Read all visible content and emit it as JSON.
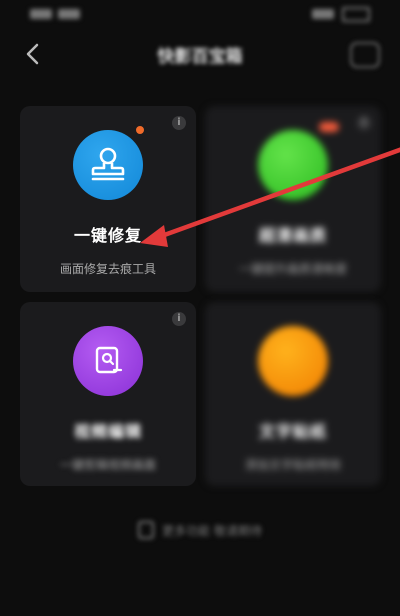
{
  "header": {
    "title": "快影百宝箱"
  },
  "cards": [
    {
      "title": "一键修复",
      "subtitle": "画面修复去痕工具"
    },
    {
      "title": "超清画质",
      "subtitle": "一键提升画质清晰度"
    },
    {
      "title": "视频编辑",
      "subtitle": "一键剪辑视频画面"
    },
    {
      "title": "文字贴纸",
      "subtitle": "添加文字贴纸特效"
    }
  ],
  "footer": {
    "text": "更多功能 敬请期待"
  },
  "colors": {
    "accent_blue": "#1e9be6",
    "accent_green": "#44cc33",
    "accent_purple": "#a046e6",
    "accent_orange": "#f59a10",
    "arrow_red": "#e23a3a"
  },
  "icons": {
    "back": "chevron-left-icon",
    "stamp": "stamp-icon",
    "info": "info-icon",
    "image-edit": "image-edit-icon"
  }
}
